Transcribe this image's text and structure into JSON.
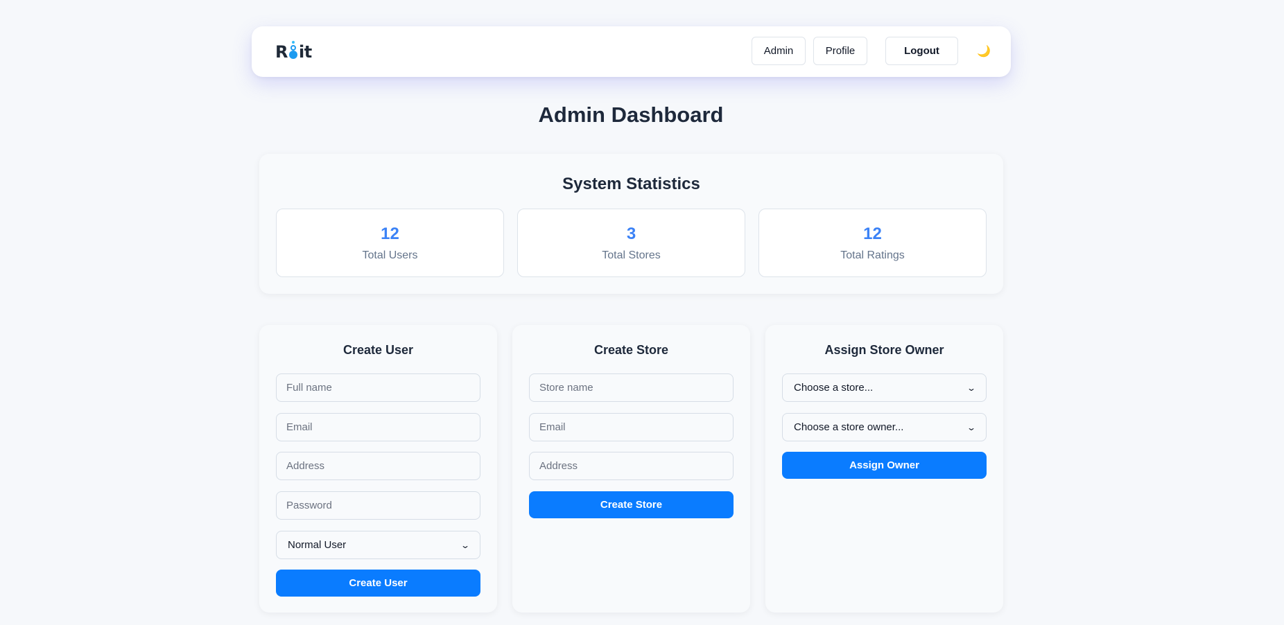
{
  "nav": {
    "logo_left": "R",
    "logo_right": "it",
    "admin_label": "Admin",
    "profile_label": "Profile",
    "logout_label": "Logout",
    "theme_icon": "moon-icon",
    "theme_glyph": "🌙"
  },
  "page": {
    "title": "Admin Dashboard"
  },
  "stats": {
    "title": "System Statistics",
    "items": [
      {
        "value": "12",
        "label": "Total Users"
      },
      {
        "value": "3",
        "label": "Total Stores"
      },
      {
        "value": "12",
        "label": "Total Ratings"
      }
    ]
  },
  "create_user": {
    "title": "Create User",
    "full_name_placeholder": "Full name",
    "email_placeholder": "Email",
    "address_placeholder": "Address",
    "password_placeholder": "Password",
    "role_selected": "Normal User",
    "submit_label": "Create User"
  },
  "create_store": {
    "title": "Create Store",
    "store_name_placeholder": "Store name",
    "email_placeholder": "Email",
    "address_placeholder": "Address",
    "submit_label": "Create Store"
  },
  "assign_owner": {
    "title": "Assign Store Owner",
    "store_selected": "Choose a store...",
    "owner_selected": "Choose a store owner...",
    "submit_label": "Assign Owner"
  },
  "colors": {
    "accent": "#0a7cff",
    "stat_value": "#3b82f6",
    "background": "#f6f8fb"
  }
}
